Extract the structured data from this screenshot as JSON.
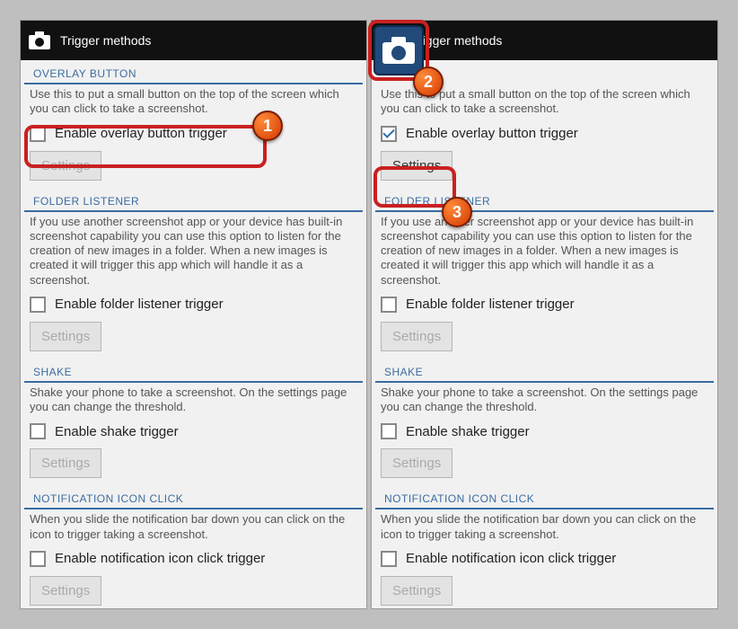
{
  "page_title": "Trigger methods",
  "icons": {
    "app_icon": "camera-icon"
  },
  "sections": {
    "overlay": {
      "header": "OVERLAY BUTTON",
      "desc": "Use this to put a small button on the top of the screen which you can click to take a screenshot.",
      "checkbox_label": "Enable overlay button trigger",
      "settings_label": "Settings"
    },
    "folder": {
      "header": "FOLDER LISTENER",
      "desc": "If you use another screenshot app or your device has built-in screenshot capability you can use this option to listen for the creation of new images in a folder. When a new images is created it will trigger this app which will handle it as a screenshot.",
      "checkbox_label": "Enable folder listener trigger",
      "settings_label": "Settings"
    },
    "shake": {
      "header": "SHAKE",
      "desc": "Shake your phone to take a screenshot. On the settings page you can change the threshold.",
      "checkbox_label": "Enable shake trigger",
      "settings_label": "Settings"
    },
    "notif": {
      "header": "NOTIFICATION ICON CLICK",
      "desc": "When you slide the notification bar down you can click on the icon to trigger taking a screenshot.",
      "checkbox_label": "Enable notification icon click trigger",
      "settings_label": "Settings"
    }
  },
  "left_panel": {
    "overlay_checked": false
  },
  "right_panel": {
    "overlay_checked": true
  },
  "callouts": {
    "n1": "1",
    "n2": "2",
    "n3": "3"
  }
}
